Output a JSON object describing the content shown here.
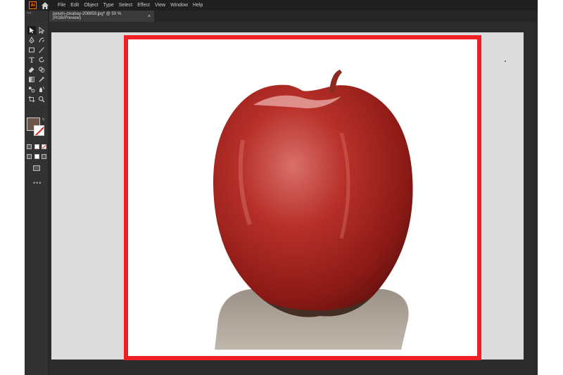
{
  "menubar": {
    "logo": "Ai",
    "items": [
      "File",
      "Edit",
      "Object",
      "Type",
      "Select",
      "Effect",
      "View",
      "Window",
      "Help"
    ]
  },
  "toolbar": {
    "collapse": "««",
    "tools": [
      "selection-tool-icon",
      "direct-selection-tool-icon",
      "pen-tool-icon",
      "curvature-tool-icon",
      "rectangle-tool-icon",
      "paintbrush-tool-icon",
      "type-tool-icon",
      "rotate-tool-icon",
      "eraser-tool-icon",
      "shape-builder-tool-icon",
      "gradient-tool-icon",
      "eyedropper-tool-icon",
      "blend-tool-icon",
      "symbol-sprayer-tool-icon",
      "artboard-tool-icon",
      "zoom-tool-icon"
    ],
    "fill_color": "#6b5648",
    "stroke_color": "none",
    "ellipsis": "•••"
  },
  "document": {
    "tab_title": "pexels-pixabay-206959.jpg* @ 50 % (RGB/Preview)",
    "close": "×"
  },
  "canvas": {
    "artboard_border_color": "#ee2025",
    "pasteboard_color": "#dcdcdc",
    "image_subject": "apple-image"
  }
}
